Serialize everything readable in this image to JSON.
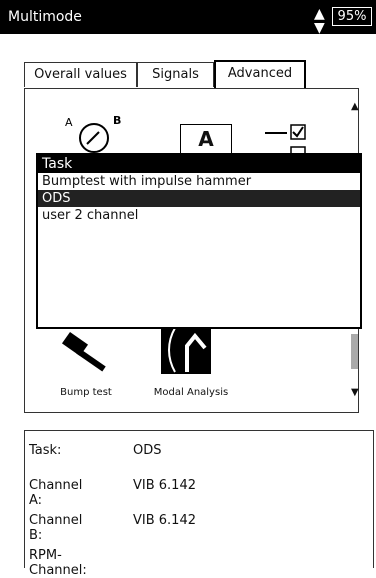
{
  "titlebar": {
    "title": "Multimode",
    "battery": "95%"
  },
  "tabs": [
    {
      "label": "Overall values",
      "active": false
    },
    {
      "label": "Signals",
      "active": false
    },
    {
      "label": "Advanced",
      "active": true
    }
  ],
  "task_popup": {
    "header": "Task",
    "items": [
      {
        "label": "Bumptest with impulse hammer",
        "selected": false
      },
      {
        "label": "ODS",
        "selected": true
      },
      {
        "label": "user 2 channel",
        "selected": false
      }
    ]
  },
  "icons": [
    {
      "name": "overall-values-icon",
      "text_a": "A",
      "text_b": "B"
    },
    {
      "name": "signal-icon",
      "letter": "A"
    },
    {
      "name": "checklist-icon"
    }
  ],
  "bottom_icons": [
    {
      "label": "Bump test"
    },
    {
      "label": "Modal Analysis"
    }
  ],
  "info": {
    "task_label": "Task:",
    "task_value": "ODS",
    "channel_a_label": "Channel A:",
    "channel_a_value": "VIB 6.142",
    "channel_b_label": "Channel B:",
    "channel_b_value": "VIB 6.142",
    "rpm_label": "RPM-Channel:",
    "rpm_value": ""
  }
}
